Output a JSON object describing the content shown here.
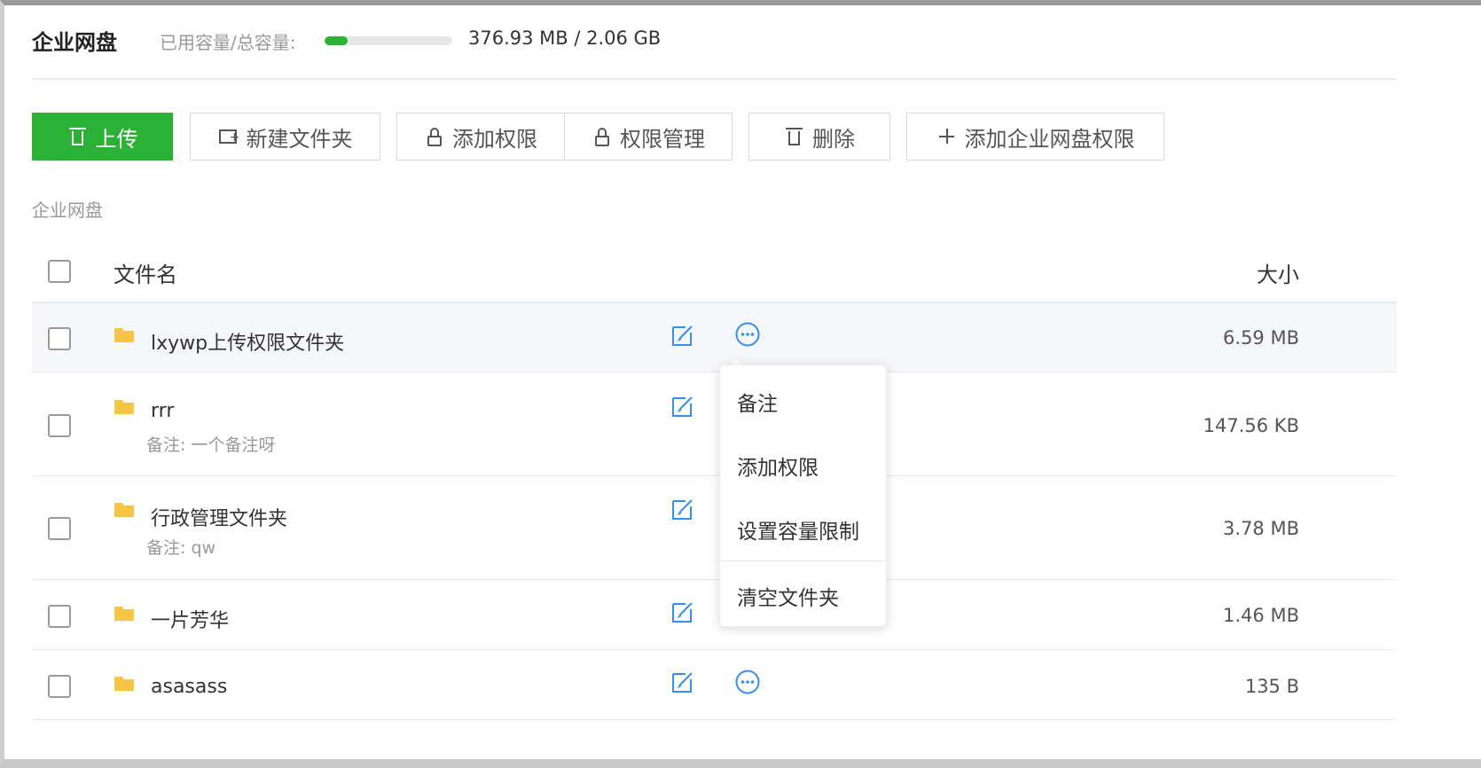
{
  "header": {
    "title": "企业网盘",
    "capacity_label": "已用容量/总容量:",
    "capacity_text": "376.93 MB / 2.06 GB",
    "used_fraction": 0.18,
    "accent_color": "#2bb236"
  },
  "toolbar": {
    "upload": "上传",
    "new_folder": "新建文件夹",
    "add_permission": "添加权限",
    "permission_management": "权限管理",
    "delete": "删除",
    "add_enterprise_permission": "添加企业网盘权限"
  },
  "breadcrumb": "企业网盘",
  "table": {
    "columns": {
      "name": "文件名",
      "size": "大小"
    },
    "rows": [
      {
        "name": "lxywp上传权限文件夹",
        "note": "",
        "size": "6.59 MB"
      },
      {
        "name": "rrr",
        "note": "备注: 一个备注呀",
        "size": "147.56 KB"
      },
      {
        "name": "行政管理文件夹",
        "note": "备注: qw",
        "size": "3.78 MB"
      },
      {
        "name": "一片芳华",
        "note": "",
        "size": "1.46 MB"
      },
      {
        "name": "asasass",
        "note": "",
        "size": "135 B"
      }
    ]
  },
  "context_menu": {
    "items": [
      "备注",
      "添加权限",
      "设置容量限制",
      "清空文件夹"
    ]
  },
  "icons": {
    "folder_color": "#f7c443",
    "action_color": "#3a8ee6"
  }
}
